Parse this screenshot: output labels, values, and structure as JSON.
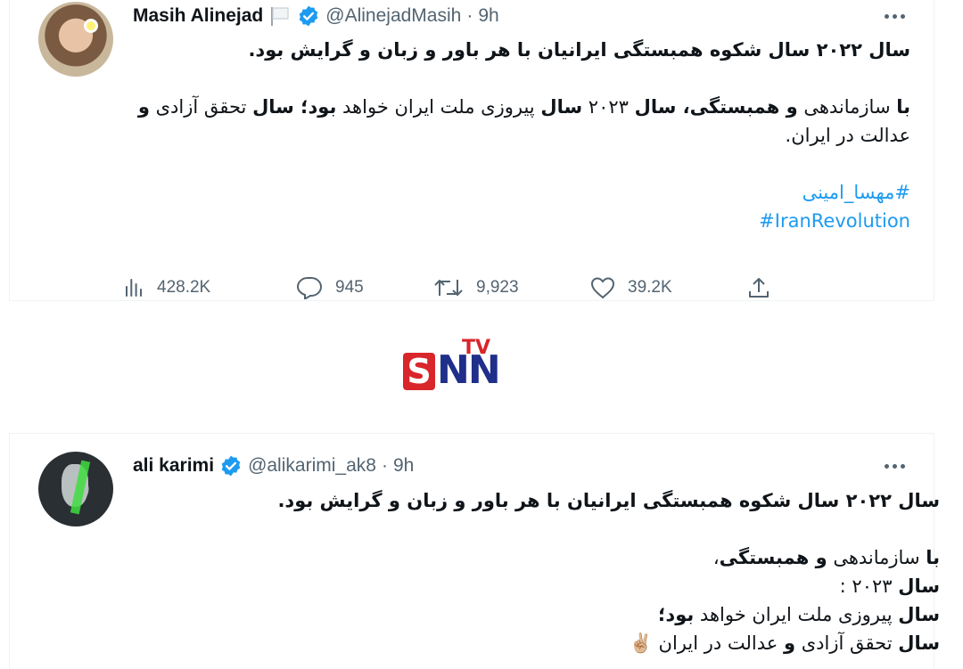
{
  "tweet1": {
    "name": "Masih Alinejad",
    "handle": "@AlinejadMasih",
    "dot": "·",
    "time": "9h",
    "line1": "سال ۲۰۲۲ سال شکوه همبستگی ایرانیان با هر باور و زبان و گرایش بود.",
    "p2_b1": "با",
    "p2_t1": " سازماندهی ",
    "p2_b2": "و همبستگی، سال",
    "p2_t2": " ۲۰۲۳ ",
    "p2_b3": "سال",
    "p2_t3": " پیروزی ملت ایران خواهد ",
    "p2_b4": "بود؛ سال",
    "p2_t4": " تحقق آزادی ",
    "p2_b5": "و",
    "p2_t5": " عدالت در ایران.",
    "hashtag1": "#مهسا_امینی",
    "hashtag2": "#IranRevolution",
    "views": "428.2K",
    "replies": "945",
    "retweets": "9,923",
    "likes": "39.2K"
  },
  "logo": {
    "s": "S",
    "nn": "NN",
    "tv": "TV"
  },
  "tweet2": {
    "name": "ali karimi",
    "handle": "@alikarimi_ak8",
    "dot": "·",
    "time": "9h",
    "line1": "سال ۲۰۲۲ سال شکوه همبستگی ایرانیان با هر باور و زبان و گرایش بود.",
    "l3_b1": "با",
    "l3_t1": " سازماندهی ",
    "l3_b2": "و همبستگی",
    "l3_t2": "،",
    "l4_b1": "سال",
    "l4_t1": " ۲۰۲۳ :",
    "l5_b1": "سال",
    "l5_t1": " پیروزی ملت ایران خواهد ",
    "l5_b2": "بود؛",
    "l6_b1": "سال",
    "l6_t1": " تحقق آزادی ",
    "l6_b2": "و",
    "l6_t2": " عدالت در ایران ",
    "l6_emoji": "✌🏼"
  },
  "colors": {
    "link": "#1d9bf0",
    "muted": "#536471",
    "verified": "#1d9bf0",
    "snn_red": "#d8262b",
    "snn_blue": "#1f2f8a"
  },
  "icons": [
    "white-flag-icon",
    "verified-badge-icon",
    "more-icon",
    "views-icon",
    "reply-icon",
    "retweet-icon",
    "like-icon",
    "share-icon"
  ]
}
